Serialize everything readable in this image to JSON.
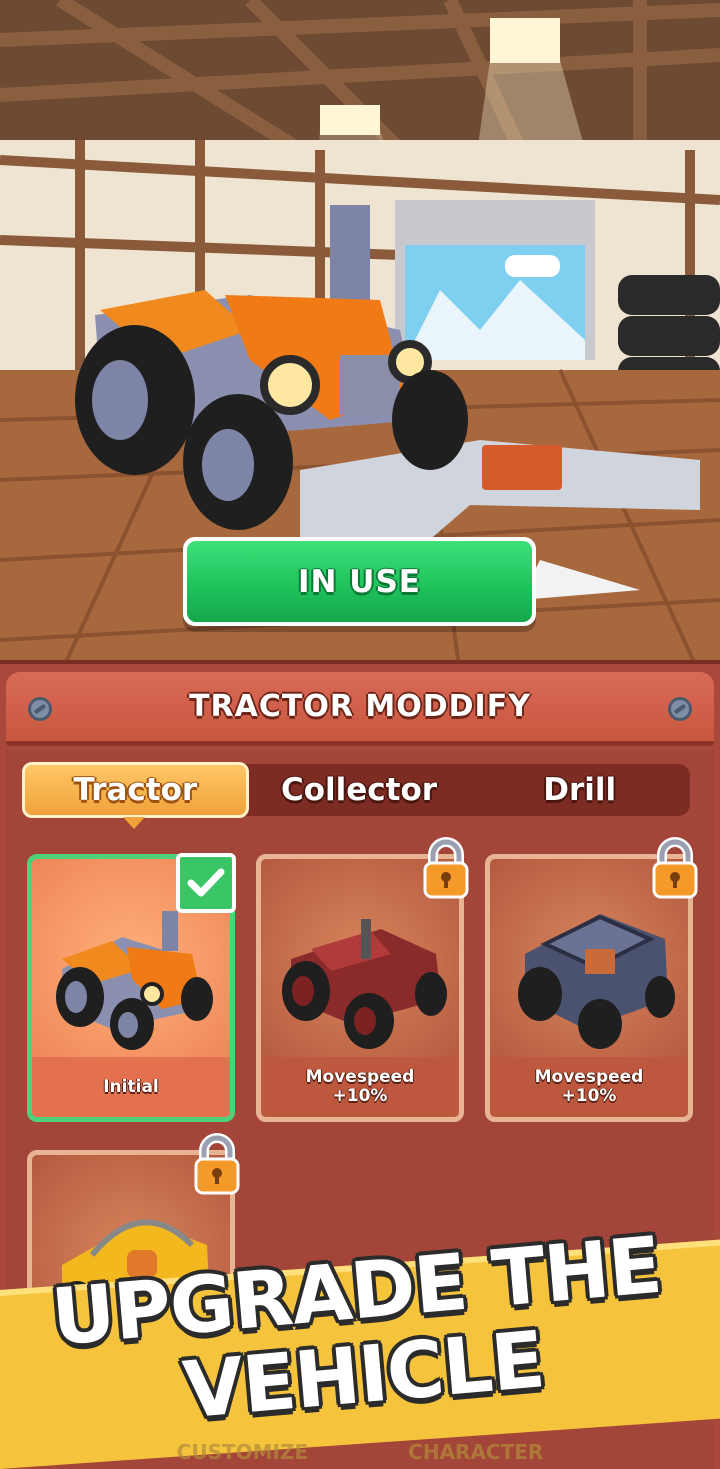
{
  "scene": {
    "in_use_label": "IN USE"
  },
  "panel": {
    "title": "TRACTOR MODDIFY",
    "tabs": [
      {
        "label": "Tractor",
        "active": true
      },
      {
        "label": "Collector",
        "active": false
      },
      {
        "label": "Drill",
        "active": false
      }
    ],
    "cards": [
      {
        "label": "Initial",
        "selected": true,
        "locked": false
      },
      {
        "label_line1": "Movespeed",
        "label_line2": "+10%",
        "locked": true
      },
      {
        "label_line1": "Movespeed",
        "label_line2": "+10%",
        "locked": true
      },
      {
        "locked": true
      }
    ]
  },
  "banner": {
    "line1": "UPGRADE THE",
    "line2": "VEHICLE"
  },
  "bottom_nav": {
    "left": "CUSTOMIZE",
    "right": "CHARACTER"
  },
  "colors": {
    "in_use_green": "#1fc35c",
    "panel_red": "#a8493b",
    "banner_yellow": "#f6c43c"
  }
}
